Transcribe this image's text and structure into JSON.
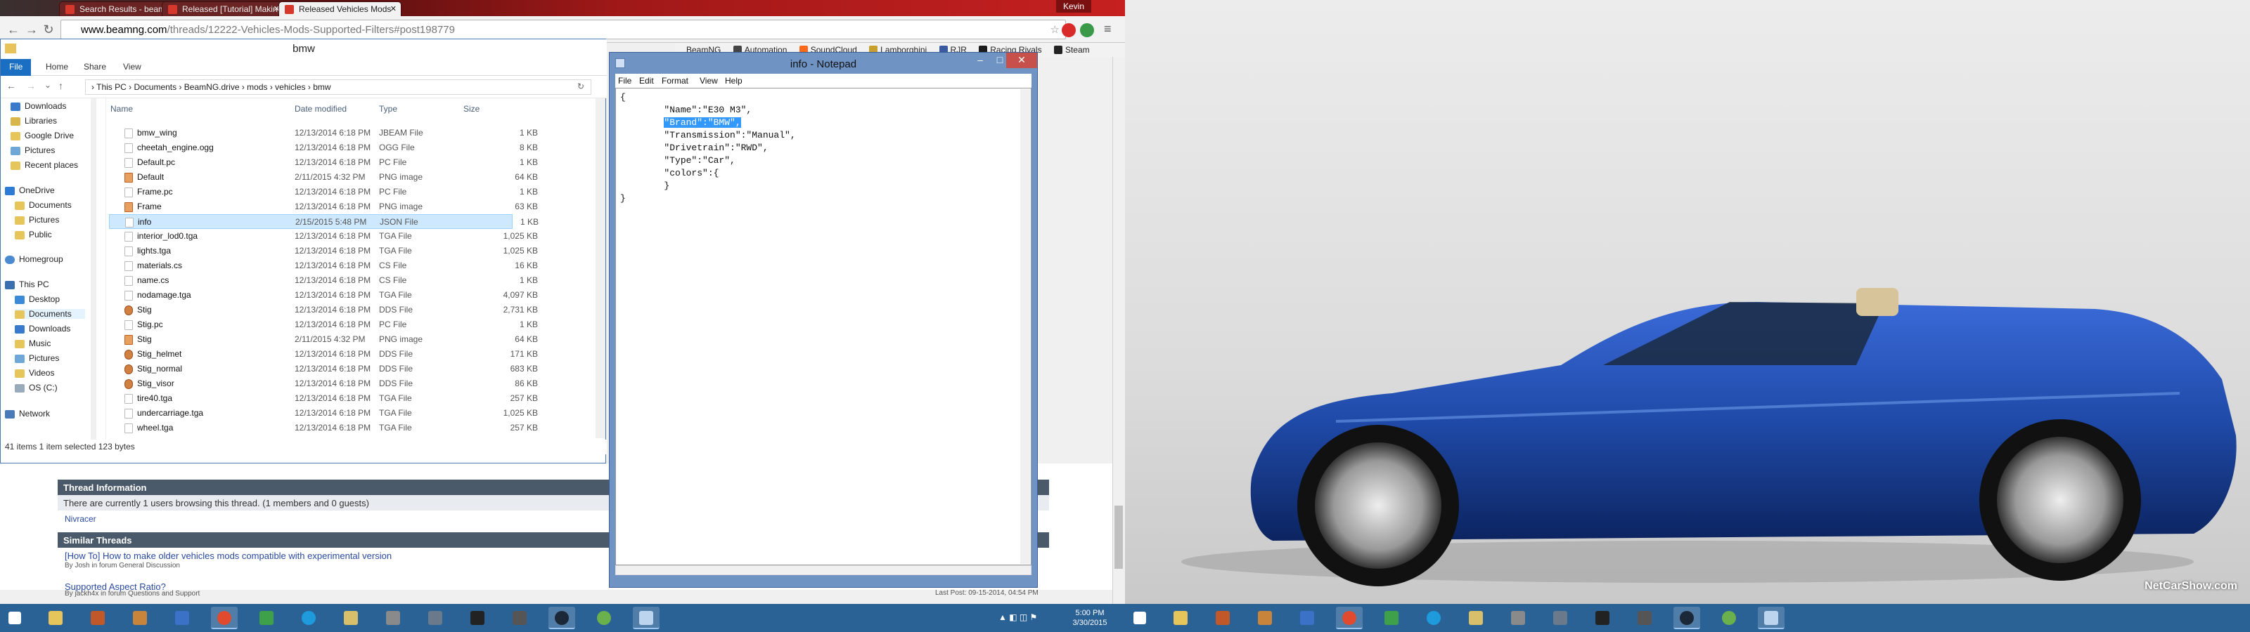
{
  "chrome": {
    "tabs": [
      {
        "label": "Search Results - beamng"
      },
      {
        "label": "Released [Tutorial] Making"
      },
      {
        "label": "Released Vehicles Mods"
      }
    ],
    "user": "Kevin",
    "url_domain": "www.beamng.com",
    "url_path": "/threads/12222-Vehicles-Mods-Supported-Filters#post198779",
    "bookmarks": [
      "BeamNG",
      "Automation",
      "SoundCloud",
      "Lamborghini",
      "RJR",
      "Racing Rivals",
      "Steam"
    ]
  },
  "explorer": {
    "title": "bmw",
    "ribbon": [
      "File",
      "Home",
      "Share",
      "View"
    ],
    "breadcrumb": "›  This PC  ›  Documents  ›  BeamNG.drive  ›  mods  ›  vehicles  ›  bmw",
    "nav": {
      "quick": [
        "Downloads",
        "Libraries",
        "Google Drive",
        "Pictures",
        "Recent places"
      ],
      "onedrive": "OneDrive",
      "onedrive_items": [
        "Documents",
        "Pictures",
        "Public"
      ],
      "homegroup": "Homegroup",
      "thispc": "This PC",
      "thispc_items": [
        "Desktop",
        "Documents",
        "Downloads",
        "Music",
        "Pictures",
        "Videos",
        "OS (C:)"
      ],
      "network": "Network"
    },
    "columns": {
      "name": "Name",
      "date": "Date modified",
      "type": "Type",
      "size": "Size"
    },
    "files": [
      {
        "name": "bmw_wing",
        "date": "12/13/2014 6:18 PM",
        "type": "JBEAM File",
        "size": "1 KB",
        "kind": "file"
      },
      {
        "name": "cheetah_engine.ogg",
        "date": "12/13/2014 6:18 PM",
        "type": "OGG File",
        "size": "8 KB",
        "kind": "file"
      },
      {
        "name": "Default.pc",
        "date": "12/13/2014 6:18 PM",
        "type": "PC File",
        "size": "1 KB",
        "kind": "file"
      },
      {
        "name": "Default",
        "date": "2/11/2015 4:32 PM",
        "type": "PNG image",
        "size": "64 KB",
        "kind": "png"
      },
      {
        "name": "Frame.pc",
        "date": "12/13/2014 6:18 PM",
        "type": "PC File",
        "size": "1 KB",
        "kind": "file"
      },
      {
        "name": "Frame",
        "date": "12/13/2014 6:18 PM",
        "type": "PNG image",
        "size": "63 KB",
        "kind": "png"
      },
      {
        "name": "info",
        "date": "2/15/2015 5:48 PM",
        "type": "JSON File",
        "size": "1 KB",
        "kind": "file",
        "selected": true
      },
      {
        "name": "interior_lod0.tga",
        "date": "12/13/2014 6:18 PM",
        "type": "TGA File",
        "size": "1,025 KB",
        "kind": "file"
      },
      {
        "name": "lights.tga",
        "date": "12/13/2014 6:18 PM",
        "type": "TGA File",
        "size": "1,025 KB",
        "kind": "file"
      },
      {
        "name": "materials.cs",
        "date": "12/13/2014 6:18 PM",
        "type": "CS File",
        "size": "16 KB",
        "kind": "file"
      },
      {
        "name": "name.cs",
        "date": "12/13/2014 6:18 PM",
        "type": "CS File",
        "size": "1 KB",
        "kind": "file"
      },
      {
        "name": "nodamage.tga",
        "date": "12/13/2014 6:18 PM",
        "type": "TGA File",
        "size": "4,097 KB",
        "kind": "file"
      },
      {
        "name": "Stig",
        "date": "12/13/2014 6:18 PM",
        "type": "DDS File",
        "size": "2,731 KB",
        "kind": "dds"
      },
      {
        "name": "Stig.pc",
        "date": "12/13/2014 6:18 PM",
        "type": "PC File",
        "size": "1 KB",
        "kind": "file"
      },
      {
        "name": "Stig",
        "date": "2/11/2015 4:32 PM",
        "type": "PNG image",
        "size": "64 KB",
        "kind": "png"
      },
      {
        "name": "Stig_helmet",
        "date": "12/13/2014 6:18 PM",
        "type": "DDS File",
        "size": "171 KB",
        "kind": "dds"
      },
      {
        "name": "Stig_normal",
        "date": "12/13/2014 6:18 PM",
        "type": "DDS File",
        "size": "683 KB",
        "kind": "dds"
      },
      {
        "name": "Stig_visor",
        "date": "12/13/2014 6:18 PM",
        "type": "DDS File",
        "size": "86 KB",
        "kind": "dds"
      },
      {
        "name": "tire40.tga",
        "date": "12/13/2014 6:18 PM",
        "type": "TGA File",
        "size": "257 KB",
        "kind": "file"
      },
      {
        "name": "undercarriage.tga",
        "date": "12/13/2014 6:18 PM",
        "type": "TGA File",
        "size": "1,025 KB",
        "kind": "file"
      },
      {
        "name": "wheel.tga",
        "date": "12/13/2014 6:18 PM",
        "type": "TGA File",
        "size": "257 KB",
        "kind": "file"
      }
    ],
    "status": "41 items     1 item selected  123 bytes"
  },
  "notepad": {
    "title": "info - Notepad",
    "menu": [
      "File",
      "Edit",
      "Format",
      "View",
      "Help"
    ],
    "lines": [
      "{",
      "        \"Name\":\"E30 M3\",",
      "        \"Brand\":\"BMW\",",
      "        \"Transmission\":\"Manual\",",
      "        \"Drivetrain\":\"RWD\",",
      "        \"Type\":\"Car\",",
      "        \"colors\":{",
      "        }",
      "}"
    ],
    "selected_text": "\"Brand\":\"BMW\","
  },
  "forum": {
    "thread_info_heading": "Thread Information",
    "browsing": "There are currently 1 users browsing this thread. (1 members and 0 guests)",
    "member": "Nivracer",
    "similar_heading": "Similar Threads",
    "threads": [
      {
        "title": "[How To] How to make older vehicles mods compatible with experimental version",
        "sub": "By Josh in forum General Discussion"
      },
      {
        "title": "Supported Aspect Ratio?",
        "sub": "By jackh4x in forum Questions and Support"
      }
    ],
    "last_post": "Last Post: 09-15-2014, 04:54 PM"
  },
  "taskbar": {
    "time": "5:00 PM",
    "date": "3/30/2015"
  },
  "wallpaper": {
    "watermark": "NetCarShow.com"
  },
  "colors": {
    "taskbar": "#2b6296",
    "selection": "#cde8ff",
    "car_body": "#1f4aa8"
  }
}
